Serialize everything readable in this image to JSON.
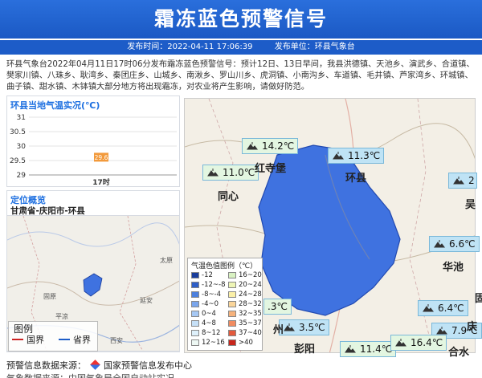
{
  "header": {
    "title": "霜冻蓝色预警信号",
    "publish_time": "发布时间：2022-04-11 17:06:39",
    "publisher": "发布单位：环县气象台"
  },
  "body": {
    "text": "环县气象台2022年04月11日17时06分发布霜冻蓝色预警信号：预计12日、13日早间，我县洪德镇、天池乡、演武乡、合道镇、樊家川镇、八珠乡、耿湾乡、秦团庄乡、山城乡、南湫乡、罗山川乡、虎洞镇、小南沟乡、车道镇、毛井镇、芦家湾乡、环城镇、曲子镇、甜水镇、木钵镇大部分地方将出现霜冻，对农业将产生影响，请做好防范。"
  },
  "temp_panel": {
    "title": "环县当地气温实况(℃)",
    "y_ticks": [
      "31",
      "30.5",
      "30",
      "29.5",
      "29"
    ],
    "x_label": "17时"
  },
  "chart_data": {
    "type": "scatter",
    "title": "环县当地气温实况(℃)",
    "x": [
      "17时"
    ],
    "values": [
      29.6
    ],
    "value_label": "29.6",
    "ylim": [
      29,
      31
    ],
    "grid": true
  },
  "location_panel": {
    "title": "定位概览",
    "region": "甘肃省-庆阳市-环县",
    "legend_title": "图例",
    "legend_county": "国界",
    "legend_province": "省界",
    "map_labels": [
      "固原",
      "平凉",
      "西安",
      "太原",
      "延安"
    ]
  },
  "main_map": {
    "places": [
      "红寺堡",
      "同心",
      "环县",
      "华池",
      "彭阳",
      "吴",
      "庆",
      "合水",
      "固",
      "州"
    ],
    "tags": [
      "14.2℃",
      "11.3℃",
      "11.0℃",
      "2",
      "6.6℃",
      "6.4℃",
      "3.5℃",
      "7.9℃",
      "11.4℃",
      "16.4℃",
      ".3℃"
    ]
  },
  "color_legend": {
    "title": "气温色值图例（℃）",
    "items": [
      {
        "label": "-12",
        "color": "#1a3d9c"
      },
      {
        "label": "16~20",
        "color": "#d9f2c2"
      },
      {
        "label": "-12~-8",
        "color": "#2e5fc7"
      },
      {
        "label": "20~24",
        "color": "#eef5b5"
      },
      {
        "label": "-8~-4",
        "color": "#4d80dd"
      },
      {
        "label": "24~28",
        "color": "#fbf0a8"
      },
      {
        "label": "-4~0",
        "color": "#7aa6ec"
      },
      {
        "label": "28~32",
        "color": "#fad59a"
      },
      {
        "label": "0~4",
        "color": "#a6c8f4"
      },
      {
        "label": "32~35",
        "color": "#f6b27c"
      },
      {
        "label": "4~8",
        "color": "#c6e0f7"
      },
      {
        "label": "35~37",
        "color": "#f18b60"
      },
      {
        "label": "8~12",
        "color": "#def0fb"
      },
      {
        "label": "37~40",
        "color": "#e35a3d"
      },
      {
        "label": "12~16",
        "color": "#eef8f4"
      },
      {
        "label": ">40",
        "color": "#c8261c"
      }
    ]
  },
  "footer": {
    "source_label": "预警信息数据来源：",
    "source_value": "国家预警信息发布中心",
    "data_source": "气象数据来源：中国气象局全国自动站实况"
  },
  "colors": {
    "banner": "#1d5cc8",
    "warning_area": "#3f72e0",
    "accent": "#1d6fe0"
  }
}
